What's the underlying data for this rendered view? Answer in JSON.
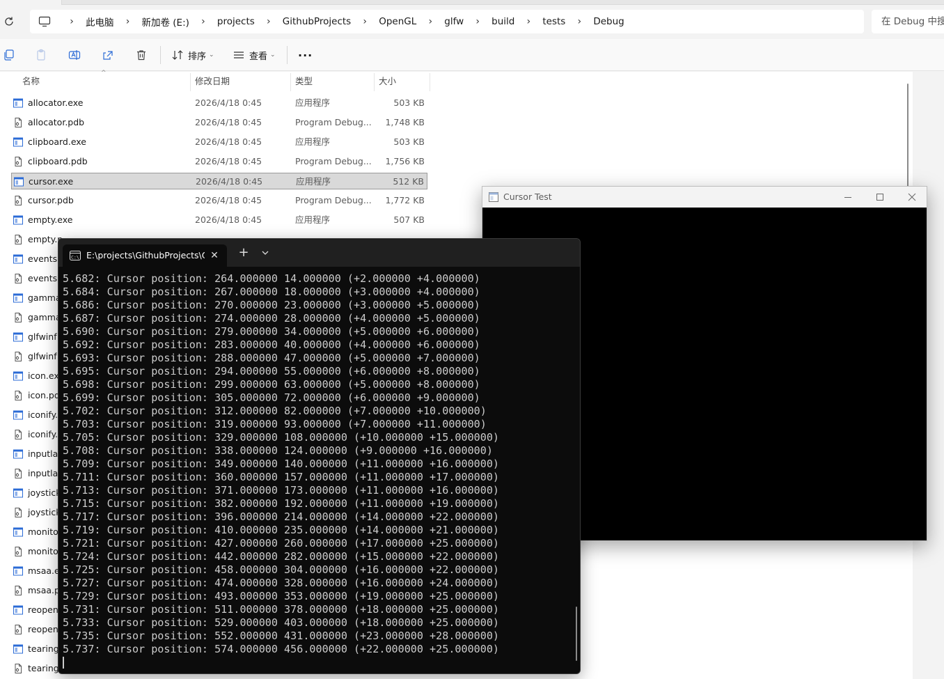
{
  "explorer": {
    "breadcrumb": [
      "此电脑",
      "新加卷 (E:)",
      "projects",
      "GithubProjects",
      "OpenGL",
      "glfw",
      "build",
      "tests",
      "Debug"
    ],
    "search_placeholder": "在 Debug 中搜索",
    "toolbar": {
      "sort_label": "排序",
      "view_label": "查看",
      "more_label": "···"
    },
    "columns": [
      "名称",
      "修改日期",
      "类型",
      "大小"
    ],
    "files": [
      {
        "name": "allocator.exe",
        "kind": "exe",
        "date": "2026/4/18 0:45",
        "type": "应用程序",
        "size": "503 KB"
      },
      {
        "name": "allocator.pdb",
        "kind": "pdb",
        "date": "2026/4/18 0:45",
        "type": "Program Debug...",
        "size": "1,748 KB"
      },
      {
        "name": "clipboard.exe",
        "kind": "exe",
        "date": "2026/4/18 0:45",
        "type": "应用程序",
        "size": "503 KB"
      },
      {
        "name": "clipboard.pdb",
        "kind": "pdb",
        "date": "2026/4/18 0:45",
        "type": "Program Debug...",
        "size": "1,756 KB"
      },
      {
        "name": "cursor.exe",
        "kind": "exe",
        "date": "2026/4/18 0:45",
        "type": "应用程序",
        "size": "512 KB",
        "selected": true
      },
      {
        "name": "cursor.pdb",
        "kind": "pdb",
        "date": "2026/4/18 0:45",
        "type": "Program Debug...",
        "size": "1,772 KB"
      },
      {
        "name": "empty.exe",
        "kind": "exe",
        "date": "2026/4/18 0:45",
        "type": "应用程序",
        "size": "507 KB"
      },
      {
        "name": "empty.p",
        "kind": "pdb",
        "date": "",
        "type": "",
        "size": ""
      },
      {
        "name": "events.",
        "kind": "exe",
        "date": "",
        "type": "",
        "size": ""
      },
      {
        "name": "events.",
        "kind": "pdb",
        "date": "",
        "type": "",
        "size": ""
      },
      {
        "name": "gamma",
        "kind": "exe",
        "date": "",
        "type": "",
        "size": ""
      },
      {
        "name": "gamma",
        "kind": "pdb",
        "date": "",
        "type": "",
        "size": ""
      },
      {
        "name": "glfwinf",
        "kind": "exe",
        "date": "",
        "type": "",
        "size": ""
      },
      {
        "name": "glfwinf",
        "kind": "pdb",
        "date": "",
        "type": "",
        "size": ""
      },
      {
        "name": "icon.ex",
        "kind": "exe",
        "date": "",
        "type": "",
        "size": ""
      },
      {
        "name": "icon.pd",
        "kind": "pdb",
        "date": "",
        "type": "",
        "size": ""
      },
      {
        "name": "iconify.",
        "kind": "exe",
        "date": "",
        "type": "",
        "size": ""
      },
      {
        "name": "iconify.",
        "kind": "pdb",
        "date": "",
        "type": "",
        "size": ""
      },
      {
        "name": "inputla",
        "kind": "exe",
        "date": "",
        "type": "",
        "size": ""
      },
      {
        "name": "inputla",
        "kind": "pdb",
        "date": "",
        "type": "",
        "size": ""
      },
      {
        "name": "joystick",
        "kind": "exe",
        "date": "",
        "type": "",
        "size": ""
      },
      {
        "name": "joystick",
        "kind": "pdb",
        "date": "",
        "type": "",
        "size": ""
      },
      {
        "name": "monito",
        "kind": "exe",
        "date": "",
        "type": "",
        "size": ""
      },
      {
        "name": "monito",
        "kind": "pdb",
        "date": "",
        "type": "",
        "size": ""
      },
      {
        "name": "msaa.e",
        "kind": "exe",
        "date": "",
        "type": "",
        "size": ""
      },
      {
        "name": "msaa.p",
        "kind": "pdb",
        "date": "",
        "type": "",
        "size": ""
      },
      {
        "name": "reopen",
        "kind": "exe",
        "date": "",
        "type": "",
        "size": ""
      },
      {
        "name": "reopen",
        "kind": "pdb",
        "date": "",
        "type": "",
        "size": ""
      },
      {
        "name": "tearing",
        "kind": "exe",
        "date": "",
        "type": "",
        "size": ""
      },
      {
        "name": "tearing",
        "kind": "pdb",
        "date": "",
        "type": "",
        "size": ""
      }
    ]
  },
  "terminal": {
    "tab_title": "E:\\projects\\GithubProjects\\Op",
    "lines": [
      "5.682: Cursor position: 264.000000 14.000000 (+2.000000 +4.000000)",
      "5.684: Cursor position: 267.000000 18.000000 (+3.000000 +4.000000)",
      "5.686: Cursor position: 270.000000 23.000000 (+3.000000 +5.000000)",
      "5.687: Cursor position: 274.000000 28.000000 (+4.000000 +5.000000)",
      "5.690: Cursor position: 279.000000 34.000000 (+5.000000 +6.000000)",
      "5.692: Cursor position: 283.000000 40.000000 (+4.000000 +6.000000)",
      "5.693: Cursor position: 288.000000 47.000000 (+5.000000 +7.000000)",
      "5.695: Cursor position: 294.000000 55.000000 (+6.000000 +8.000000)",
      "5.698: Cursor position: 299.000000 63.000000 (+5.000000 +8.000000)",
      "5.699: Cursor position: 305.000000 72.000000 (+6.000000 +9.000000)",
      "5.702: Cursor position: 312.000000 82.000000 (+7.000000 +10.000000)",
      "5.703: Cursor position: 319.000000 93.000000 (+7.000000 +11.000000)",
      "5.705: Cursor position: 329.000000 108.000000 (+10.000000 +15.000000)",
      "5.708: Cursor position: 338.000000 124.000000 (+9.000000 +16.000000)",
      "5.709: Cursor position: 349.000000 140.000000 (+11.000000 +16.000000)",
      "5.711: Cursor position: 360.000000 157.000000 (+11.000000 +17.000000)",
      "5.713: Cursor position: 371.000000 173.000000 (+11.000000 +16.000000)",
      "5.715: Cursor position: 382.000000 192.000000 (+11.000000 +19.000000)",
      "5.717: Cursor position: 396.000000 214.000000 (+14.000000 +22.000000)",
      "5.719: Cursor position: 410.000000 235.000000 (+14.000000 +21.000000)",
      "5.721: Cursor position: 427.000000 260.000000 (+17.000000 +25.000000)",
      "5.724: Cursor position: 442.000000 282.000000 (+15.000000 +22.000000)",
      "5.725: Cursor position: 458.000000 304.000000 (+16.000000 +22.000000)",
      "5.727: Cursor position: 474.000000 328.000000 (+16.000000 +24.000000)",
      "5.729: Cursor position: 493.000000 353.000000 (+19.000000 +25.000000)",
      "5.731: Cursor position: 511.000000 378.000000 (+18.000000 +25.000000)",
      "5.733: Cursor position: 529.000000 403.000000 (+18.000000 +25.000000)",
      "5.735: Cursor position: 552.000000 431.000000 (+23.000000 +28.000000)",
      "5.737: Cursor position: 574.000000 456.000000 (+22.000000 +25.000000)"
    ]
  },
  "glfw_window": {
    "title": "Cursor Test"
  },
  "icons": {
    "refresh": "refresh-icon",
    "pc": "computer-icon",
    "copy": "copy-icon",
    "paste": "paste-icon",
    "rename": "rename-icon",
    "share": "share-icon",
    "delete": "trash-icon",
    "sort": "sort-icon",
    "view": "view-icon",
    "exe": "application-icon",
    "pdb": "document-icon",
    "terminal": "terminal-icon"
  },
  "colors": {
    "selection": "#d9d9d9",
    "terminal_bg": "#0c0c0c",
    "terminal_fg": "#cccccc",
    "exe_icon_blue": "#2b6bd6"
  }
}
